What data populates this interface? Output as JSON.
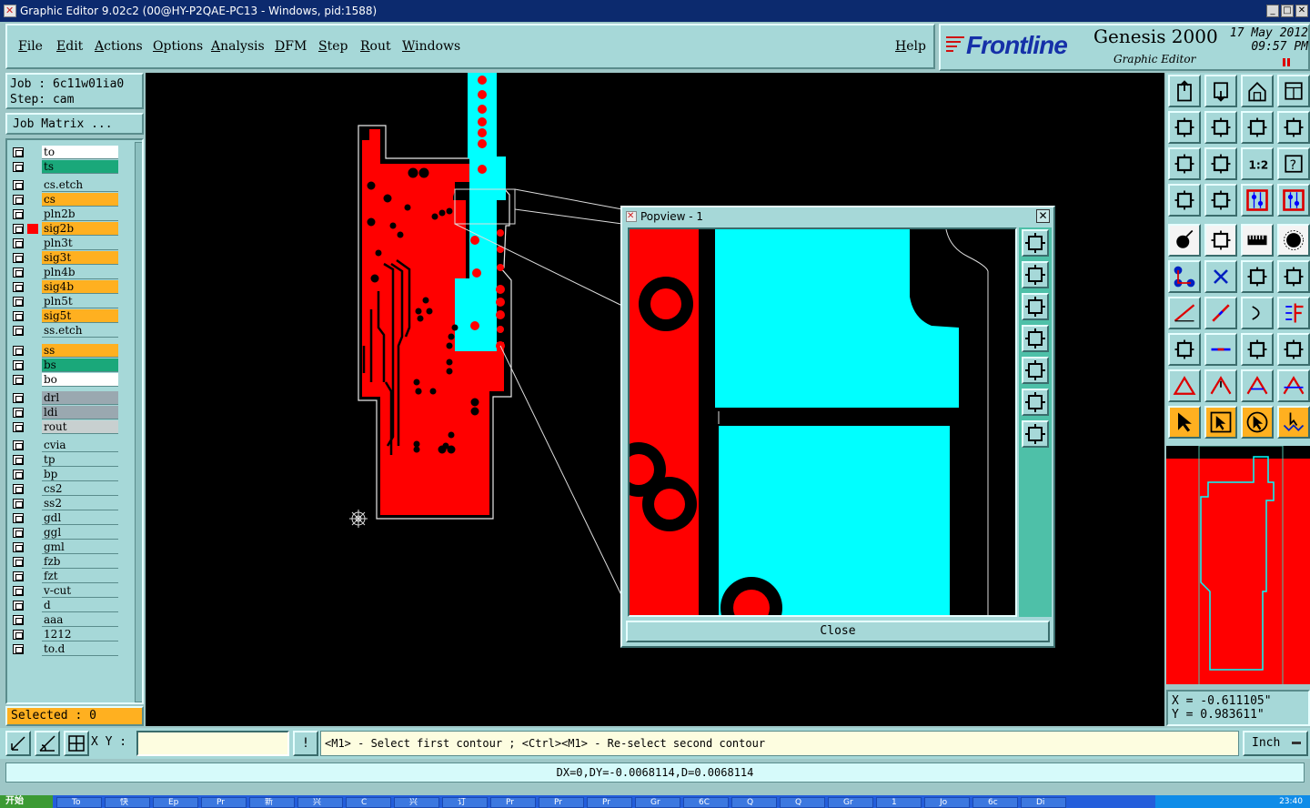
{
  "window": {
    "title": "Graphic Editor 9.02c2 (00@HY-P2QAE-PC13 - Windows, pid:1588)",
    "min": "_",
    "max": "□",
    "close": "✕"
  },
  "menu": {
    "items": [
      "File",
      "Edit",
      "Actions",
      "Options",
      "Analysis",
      "DFM",
      "Step",
      "Rout",
      "Windows"
    ],
    "help": "Help"
  },
  "brand": {
    "logo": "Frontline",
    "product": "Genesis 2000",
    "subtitle": "Graphic Editor",
    "date": "17 May 2012",
    "time": "09:57 PM"
  },
  "job": {
    "job_line": "Job : 6c11w01ia0",
    "step_line": "Step: cam",
    "matrix_button": "Job Matrix ..."
  },
  "layers": [
    {
      "name": "to",
      "color": "#ffffff"
    },
    {
      "name": "ts",
      "color": "#1aa87a"
    },
    {
      "name": "cs.etch",
      "color": "#a6d8d8"
    },
    {
      "name": "cs",
      "color": "#ffb020"
    },
    {
      "name": "pln2b",
      "color": "#a6d8d8"
    },
    {
      "name": "sig2b",
      "color": "#ffb020"
    },
    {
      "name": "pln3t",
      "color": "#a6d8d8"
    },
    {
      "name": "sig3t",
      "color": "#ffb020"
    },
    {
      "name": "pln4b",
      "color": "#a6d8d8"
    },
    {
      "name": "sig4b",
      "color": "#ffb020"
    },
    {
      "name": "pln5t",
      "color": "#a6d8d8"
    },
    {
      "name": "sig5t",
      "color": "#ffb020"
    },
    {
      "name": "ss.etch",
      "color": "#a6d8d8"
    },
    {
      "name": "ss",
      "color": "#ffb020"
    },
    {
      "name": "bs",
      "color": "#1aa87a"
    },
    {
      "name": "bo",
      "color": "#ffffff"
    },
    {
      "name": "drl",
      "color": "#9aa8b0"
    },
    {
      "name": "ldi",
      "color": "#9aa8b0"
    },
    {
      "name": "rout",
      "color": "#c8d0d0"
    },
    {
      "name": "cvia",
      "color": "#a6d8d8"
    },
    {
      "name": "tp",
      "color": "#a6d8d8"
    },
    {
      "name": "bp",
      "color": "#a6d8d8"
    },
    {
      "name": "cs2",
      "color": "#a6d8d8"
    },
    {
      "name": "ss2",
      "color": "#a6d8d8"
    },
    {
      "name": "gdl",
      "color": "#a6d8d8"
    },
    {
      "name": "ggl",
      "color": "#a6d8d8"
    },
    {
      "name": "gml",
      "color": "#a6d8d8"
    },
    {
      "name": "fzb",
      "color": "#a6d8d8"
    },
    {
      "name": "fzt",
      "color": "#a6d8d8"
    },
    {
      "name": "v-cut",
      "color": "#a6d8d8"
    },
    {
      "name": "d",
      "color": "#a6d8d8"
    },
    {
      "name": "aaa",
      "color": "#a6d8d8"
    },
    {
      "name": "1212",
      "color": "#a6d8d8"
    },
    {
      "name": "to.d",
      "color": "#a6d8d8"
    }
  ],
  "selected": "Selected : 0",
  "popview": {
    "title": "Popview - 1",
    "close_x": "✕",
    "close_button": "Close"
  },
  "coords": {
    "x": "X = -0.611105\"",
    "y": "Y = 0.983611\""
  },
  "bottom": {
    "xy_label": "X Y :",
    "xy_value": "",
    "info_button": "!",
    "prompt": "<M1> - Select first contour ; <Ctrl><M1> - Re-select second contour",
    "units": "Inch",
    "measure": "DX=0,DY=-0.0068114,D=0.0068114"
  },
  "taskbar": {
    "start": "开始",
    "tasks": [
      "To",
      "快",
      "Ep",
      "Pr",
      "新",
      "兴",
      "C",
      "兴",
      "订",
      "Pr",
      "Pr",
      "Pr",
      "Gr",
      "6C",
      "Q",
      "Q",
      "Gr",
      "1",
      "Jo",
      "6c",
      "Di"
    ],
    "clock": "23:40"
  },
  "colors": {
    "copper": "#ff0000",
    "selected_layer": "#00ffff",
    "panel": "#a6d8d8"
  }
}
